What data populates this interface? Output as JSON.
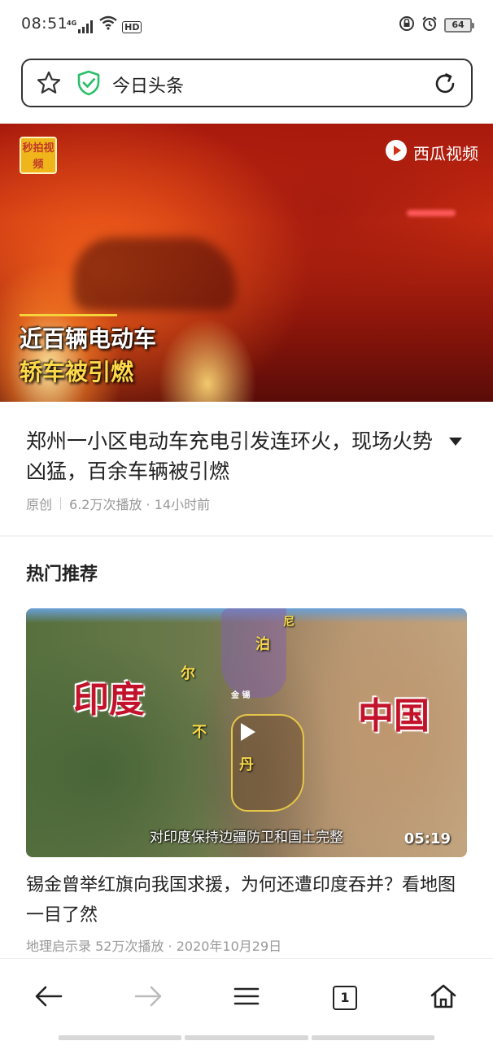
{
  "status_bar": {
    "time": "08:51",
    "network": "4G",
    "hd": "HD",
    "battery": "64"
  },
  "address_bar": {
    "title": "今日头条",
    "security_color": "#2bbf6a"
  },
  "hero_video": {
    "badge": "秒拍视频",
    "brand": "西瓜视频",
    "caption_line1": "近百辆电动车",
    "caption_line2": "轿车被引燃"
  },
  "article": {
    "title": "郑州一小区电动车充电引发连环火，现场火势凶猛，百余车辆被引燃",
    "source": "原创",
    "stats": "6.2万次播放 · 14小时前"
  },
  "recommendations": {
    "section_title": "热门推荐",
    "items": [
      {
        "thumb": {
          "label_india": "印度",
          "label_china": "中国",
          "label_ni": "尼",
          "label_bo": "泊",
          "label_er": "尔",
          "label_bu": "不",
          "label_dan": "丹",
          "label_sikkim": "金 锡",
          "subtitle": "对印度保持边疆防卫和国土完整",
          "duration": "05:19"
        },
        "title": "锡金曾举红旗向我国求援，为何还遭印度吞并？看地图一目了然",
        "meta": "地理启示录  52万次播放 · 2020年10月29日"
      }
    ]
  },
  "bottom_nav": {
    "tab_count": "1"
  },
  "colors": {
    "text_primary": "#222222",
    "text_secondary": "#999999",
    "map_label": "#c3132b"
  }
}
